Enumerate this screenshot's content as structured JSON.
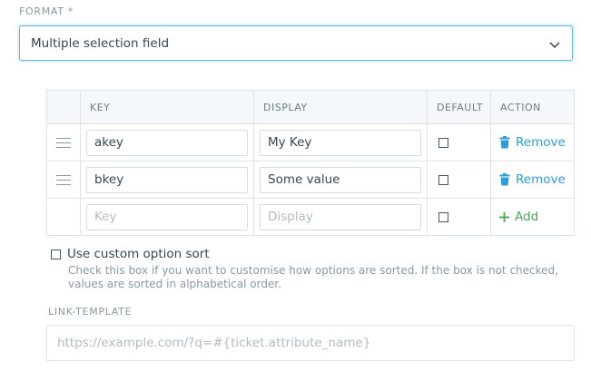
{
  "format": {
    "label": "FORMAT *",
    "selected": "Multiple selection field"
  },
  "options_table": {
    "headers": [
      "KEY",
      "DISPLAY",
      "DEFAULT",
      "ACTION"
    ],
    "rows": [
      {
        "key": "akey",
        "display": "My Key",
        "default": false,
        "action": "Remove"
      },
      {
        "key": "bkey",
        "display": "Some value",
        "default": false,
        "action": "Remove"
      }
    ],
    "new_row": {
      "key_placeholder": "Key",
      "display_placeholder": "Display",
      "default": false,
      "action": "Add"
    }
  },
  "custom_sort": {
    "label": "Use custom option sort",
    "checked": false,
    "help": "Check this box if you want to customise how options are sorted. If the box is not checked, values are sorted in alphabetical order."
  },
  "link_template": {
    "label": "LINK-TEMPLATE",
    "placeholder": "https://example.com/?q=#{ticket.attribute_name}"
  },
  "colors": {
    "accent": "#2f9cd6",
    "add": "#4aa55c",
    "focus_border": "#5fb4e3"
  }
}
